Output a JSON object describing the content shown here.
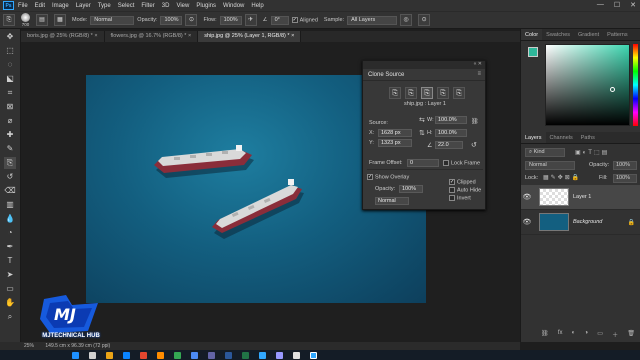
{
  "app": {
    "logo_text": "Ps"
  },
  "menu": [
    "File",
    "Edit",
    "Image",
    "Layer",
    "Type",
    "Select",
    "Filter",
    "3D",
    "View",
    "Plugins",
    "Window",
    "Help"
  ],
  "window_controls": [
    "—",
    "☐",
    "✕"
  ],
  "options": {
    "brush_size": "700",
    "mode_label": "Mode:",
    "mode_value": "Normal",
    "opacity_label": "Opacity:",
    "opacity_value": "100%",
    "flow_label": "Flow:",
    "flow_value": "100%",
    "angle_value": "0°",
    "aligned_label": "Aligned",
    "sample_label": "Sample:",
    "sample_value": "All Layers"
  },
  "tabs": [
    {
      "label": "boris.jpg @ 25% (RGB/8) *  ×"
    },
    {
      "label": "flowers.jpg @ 16.7% (RGB/8) *  ×"
    },
    {
      "label": "ship.jpg @ 25% (Layer 1, RGB/8) *  ×"
    }
  ],
  "clone_source": {
    "title": "Clone Source",
    "doc_label": "ship.jpg : Layer 1",
    "source_label": "Source:",
    "x_label": "X:",
    "x_value": "1628 px",
    "y_label": "Y:",
    "y_value": "1323 px",
    "w_label": "W:",
    "w_value": "100.0%",
    "h_label": "H:",
    "h_value": "100.0%",
    "angle_value": "22.0",
    "frame_offset_label": "Frame Offset:",
    "frame_offset_value": "0",
    "lock_frame_label": "Lock Frame",
    "show_overlay_label": "Show Overlay",
    "opacity_label": "Opacity:",
    "opacity_value": "100%",
    "blend_value": "Normal",
    "clipped_label": "Clipped",
    "auto_hide_label": "Auto Hide",
    "invert_label": "Invert"
  },
  "color_panel": {
    "tabs": [
      "Color",
      "Swatches",
      "Gradient",
      "Patterns"
    ],
    "fg_color": "#2fb79a",
    "bg_color": "#ffffff"
  },
  "layers_panel": {
    "tabs": [
      "Layers",
      "Channels",
      "Paths"
    ],
    "kind_value": "Kind",
    "blend_value": "Normal",
    "opacity_label": "Opacity:",
    "opacity_value": "100%",
    "lock_label": "Lock:",
    "fill_label": "Fill:",
    "fill_value": "100%",
    "layers": [
      {
        "name": "Layer 1"
      },
      {
        "name": "Background"
      }
    ],
    "footer_icons": [
      "⛓",
      "fx",
      "◐",
      "◑",
      "▭",
      "＋",
      "🗑"
    ]
  },
  "status": {
    "zoom": "25%",
    "doc_info": "149.5 cm x 96.39 cm (72 ppi)"
  },
  "watermark": {
    "mark": "MJ",
    "text": "MJTECHNICAL HUB"
  },
  "photo_colors": {
    "sea": "#135f80",
    "hull": "#8a2d3a",
    "deck": "#d9d9d9"
  }
}
